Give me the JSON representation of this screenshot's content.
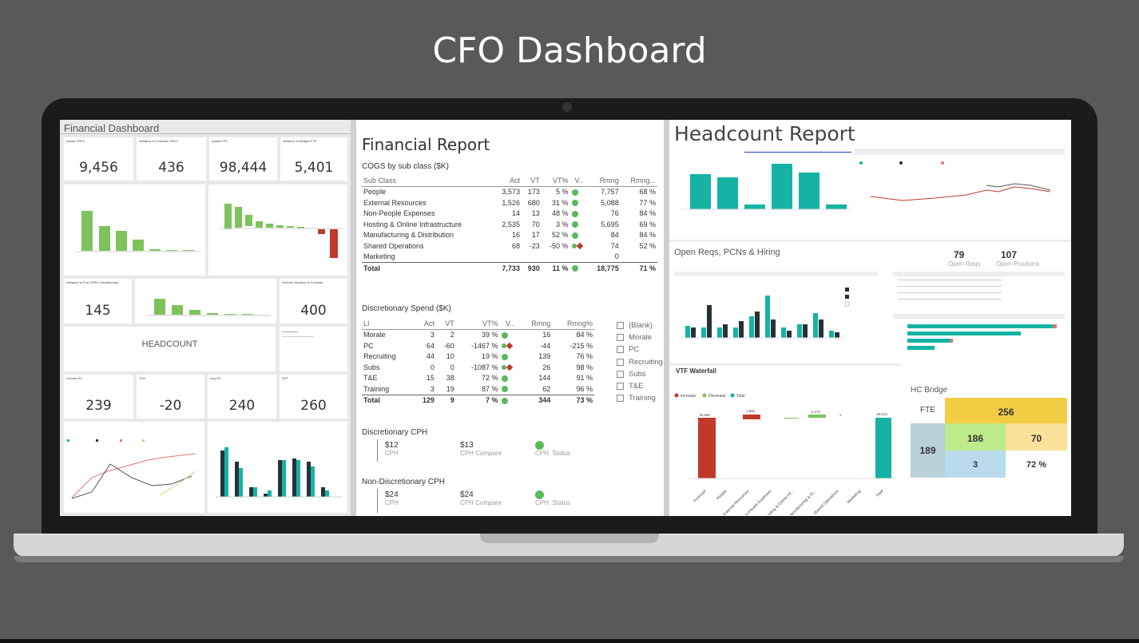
{
  "page": {
    "title": "CFO Dashboard"
  },
  "financial_dashboard": {
    "title": "Financial Dashboard",
    "kpis_top": [
      {
        "label": "Actual OPEX",
        "value": "9,456"
      },
      {
        "label": "Variance to Forecast OPEX",
        "value": "436"
      },
      {
        "label": "Actual FTE",
        "value": "98,444"
      },
      {
        "label": "Variance to Budget FTE",
        "value": "5,401"
      }
    ],
    "kpis_mid": [
      {
        "label": "Variance to Fcst OPEX Discretionary",
        "value": "145"
      },
      {
        "label": "Outlook Variance to Forecast",
        "value": "400"
      }
    ],
    "headcount_label": "HEADCOUNT",
    "kpis_hc": [
      {
        "label": "Current HC",
        "value": "239"
      },
      {
        "label": "VTB",
        "value": "-20"
      },
      {
        "label": "Avg HC",
        "value": "240"
      },
      {
        "label": "ATP",
        "value": "260"
      }
    ]
  },
  "financial_report": {
    "title": "Financial Report",
    "cogs": {
      "heading": "COGS by sub class ($K)",
      "columns": [
        "Sub Class",
        "Act",
        "VT",
        "VT%",
        "V..",
        "Rmng",
        "Rmng..."
      ],
      "rows": [
        {
          "name": "People",
          "act": "3,573",
          "vt": "173",
          "vtp": "5 %",
          "status": "green",
          "rmng": "7,757",
          "rmngp": "68 %"
        },
        {
          "name": "External Resources",
          "act": "1,526",
          "vt": "680",
          "vtp": "31 %",
          "status": "green",
          "rmng": "5,088",
          "rmngp": "77 %"
        },
        {
          "name": "Non-People Expenses",
          "act": "14",
          "vt": "13",
          "vtp": "48 %",
          "status": "green",
          "rmng": "76",
          "rmngp": "84 %"
        },
        {
          "name": "Hosting & Online Infrastructure",
          "act": "2,535",
          "vt": "70",
          "vtp": "3 %",
          "status": "green",
          "rmng": "5,695",
          "rmngp": "69 %"
        },
        {
          "name": "Manufacturing & Distribution",
          "act": "16",
          "vt": "17",
          "vtp": "52 %",
          "status": "green",
          "rmng": "84",
          "rmngp": "84 %"
        },
        {
          "name": "Shared Operations",
          "act": "68",
          "vt": "-23",
          "vtp": "-50 %",
          "status": "red",
          "rmng": "74",
          "rmngp": "52 %"
        },
        {
          "name": "Marketing",
          "act": "",
          "vt": "",
          "vtp": "",
          "status": "",
          "rmng": "0",
          "rmngp": ""
        }
      ],
      "total": {
        "name": "Total",
        "act": "7,733",
        "vt": "930",
        "vtp": "11 %",
        "status": "green",
        "rmng": "18,775",
        "rmngp": "71 %"
      }
    },
    "discretionary": {
      "heading": "Discretionary Spend ($K)",
      "columns": [
        "LI",
        "Act",
        "VT",
        "VT%",
        "V..",
        "Rmng",
        "Rmng%"
      ],
      "rows": [
        {
          "name": "Morale",
          "act": "3",
          "vt": "2",
          "vtp": "39 %",
          "status": "green",
          "rmng": "16",
          "rmngp": "84 %"
        },
        {
          "name": "PC",
          "act": "64",
          "vt": "-60",
          "vtp": "-1467 %",
          "status": "red",
          "rmng": "-44",
          "rmngp": "-215 %"
        },
        {
          "name": "Recruiting",
          "act": "44",
          "vt": "10",
          "vtp": "19 %",
          "status": "green",
          "rmng": "139",
          "rmngp": "76 %"
        },
        {
          "name": "Subs",
          "act": "0",
          "vt": "0",
          "vtp": "-1087 %",
          "status": "red",
          "rmng": "26",
          "rmngp": "98 %"
        },
        {
          "name": "T&E",
          "act": "15",
          "vt": "38",
          "vtp": "72 %",
          "status": "green",
          "rmng": "144",
          "rmngp": "91 %"
        },
        {
          "name": "Training",
          "act": "3",
          "vt": "19",
          "vtp": "87 %",
          "status": "green",
          "rmng": "62",
          "rmngp": "96 %"
        }
      ],
      "total": {
        "name": "Total",
        "act": "129",
        "vt": "9",
        "vtp": "7 %",
        "status": "green",
        "rmng": "344",
        "rmngp": "73 %"
      }
    },
    "slicer": [
      "(Blank)",
      "Morale",
      "PC",
      "Recruiting",
      "Subs",
      "T&E",
      "Training"
    ],
    "disc_cph": {
      "heading": "Discretionary CPH",
      "cph": "$12",
      "cph_label": "CPH",
      "compare": "$13",
      "compare_label": "CPH Compare",
      "status_label": "CPH. Status"
    },
    "nondisc_cph": {
      "heading": "Non-Discretionary CPH",
      "cph": "$24",
      "cph_label": "CPH",
      "compare": "$24",
      "compare_label": "CPH Compare",
      "status_label": "CPH. Status"
    }
  },
  "headcount_report": {
    "title": "Headcount Report",
    "open_reqs_title": "Open Reqs, PCNs & Hiring",
    "open_reqs_kpi": {
      "value": "79",
      "label": "Open Reqs"
    },
    "open_pos_kpi": {
      "value": "107",
      "label": "Open Positions"
    },
    "vtf_title": "VTF Waterfall",
    "hc_bridge": {
      "title": "HC Bridge",
      "fte_label": "FTE",
      "top_value": "256",
      "left_value": "189",
      "mid_value": "186",
      "right_value": "70",
      "bottom_value": "3",
      "pct_value": "72 %"
    },
    "waterfall_legend": [
      "Increase",
      "Decrease",
      "Total"
    ],
    "waterfall_categories": [
      "Forecast",
      "People",
      "External Resources",
      "Non-People Expenses",
      "Hosting & Online Inf...",
      "Manufacturing & Di...",
      "Shared Operations",
      "Marketing",
      "Total"
    ],
    "waterfall_labels": [
      "19,360",
      "",
      "1,691",
      "",
      "",
      "-1,174",
      "-1",
      "",
      "19,613"
    ],
    "colors": {
      "teal": "#16b3a4",
      "green": "#7dc35a",
      "red": "#c0392b",
      "dark": "#263238",
      "yellow": "#f3cc45",
      "lightgreen": "#bdea8a",
      "lightblue": "#b9dcec"
    }
  }
}
